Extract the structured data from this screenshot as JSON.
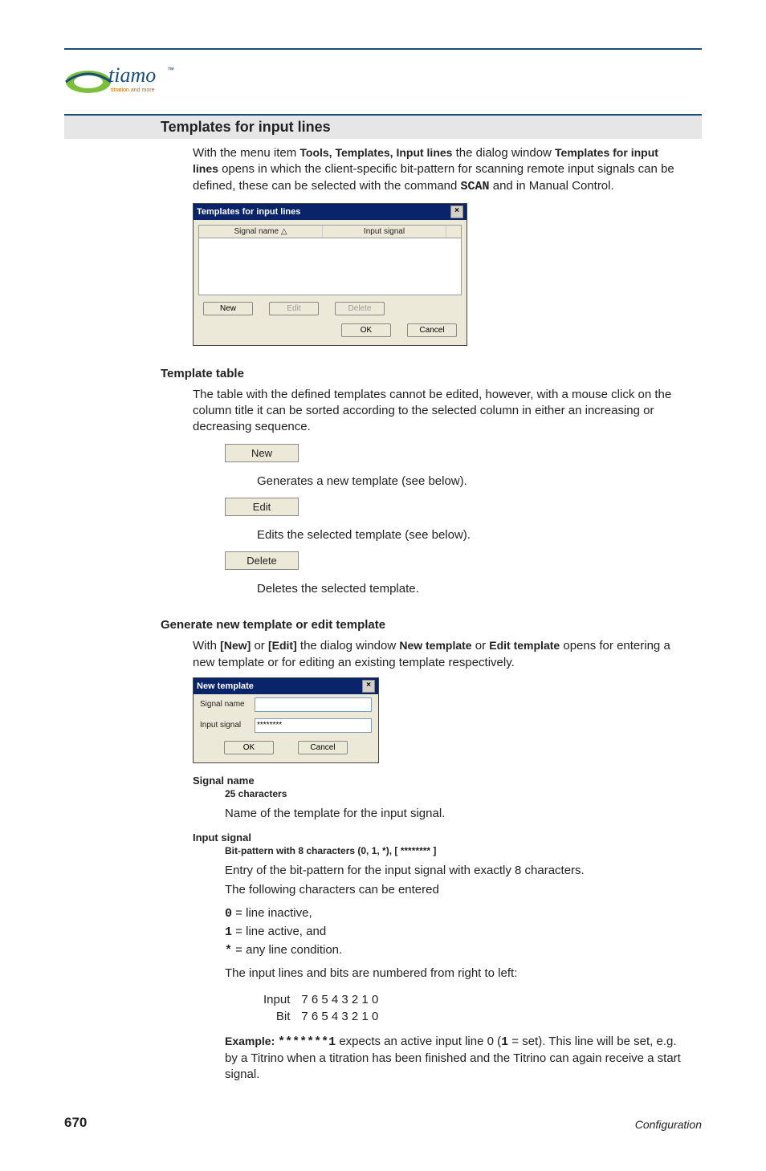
{
  "logo": {
    "brand": "tiamo",
    "tm": "™",
    "tagline": "titration and more"
  },
  "h1": "Templates for input lines",
  "intro": {
    "pre": "With the menu item ",
    "menu": "Tools, Templates, Input lines",
    "mid": " the dialog window ",
    "win": "Templates for input lines",
    "post1": " opens in which the client-specific bit-pattern for scanning remote input signals can be defined, these can be selected with the command ",
    "cmd": "SCAN",
    "post2": " and in Manual Control."
  },
  "dialog1": {
    "title": "Templates for input lines",
    "col1": "Signal name △",
    "col2": "Input signal",
    "new": "New",
    "edit": "Edit",
    "delete": "Delete",
    "ok": "OK",
    "cancel": "Cancel"
  },
  "tableSection": {
    "heading": "Template table",
    "para": "The table with the defined templates cannot be edited, however, with a mouse click on the column title it can be sorted according to the selected column in either an increasing or decreasing sequence.",
    "newBtn": "New",
    "newDesc": "Generates a new template (see below).",
    "editBtn": "Edit",
    "editDesc": "Edits the selected template (see below).",
    "delBtn": "Delete",
    "delDesc": "Deletes the selected template."
  },
  "genSection": {
    "heading": "Generate new template or edit template",
    "p": {
      "pre": "With ",
      "new": "[New]",
      "or": " or ",
      "edit": "[Edit]",
      "mid": " the dialog window ",
      "w1": "New template",
      "or2": " or ",
      "w2": "Edit template",
      "post": " opens for entering a new template or for editing an existing template respectively."
    }
  },
  "dialog2": {
    "title": "New template",
    "signalLabel": "Signal name",
    "signalValue": "",
    "inputLabel": "Input signal",
    "inputValue": "********",
    "ok": "OK",
    "cancel": "Cancel"
  },
  "signalField": {
    "label": "Signal name",
    "constraint": "25 characters",
    "desc": "Name of the template for the input signal."
  },
  "inputField": {
    "label": "Input signal",
    "constraint": "Bit-pattern with 8 characters (0, 1, *), [ ******** ]",
    "line1": "Entry of the bit-pattern for the input signal with exactly 8 characters.",
    "line2": "The following characters can be entered",
    "c0": "0",
    "c0d": " = line inactive,",
    "c1": "1",
    "c1d": " = line active, and",
    "cs": "*",
    "csd": " = any line condition.",
    "line3": "The input lines and bits are numbered from right to left:",
    "tbl": {
      "r1l": "Input",
      "r1v": "7 6 5 4 3 2 1 0",
      "r2l": "Bit",
      "r2v": "7 6 5 4 3 2 1 0"
    },
    "ex": {
      "lead": "Example: ",
      "pat": "*******1",
      "mid": " expects an active input line 0 (",
      "one": "1",
      "post": " = set). This line will be set, e.g. by a Titrino when a titration has been finished and the Titrino can again receive a start signal."
    }
  },
  "footer": {
    "page": "670",
    "section": "Configuration"
  }
}
